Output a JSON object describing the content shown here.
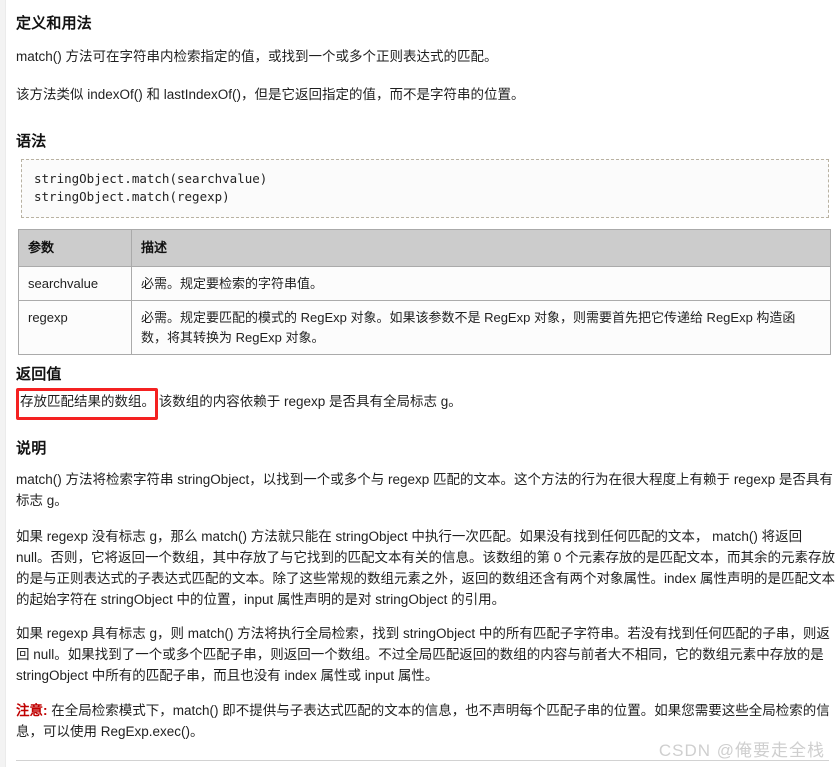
{
  "page": {
    "watermark": "CSDN @俺要走全栈"
  },
  "definition": {
    "heading": "定义和用法",
    "paragraphs": [
      "match() 方法可在字符串内检索指定的值，或找到一个或多个正则表达式的匹配。",
      "该方法类似 indexOf() 和 lastIndexOf()，但是它返回指定的值，而不是字符串的位置。"
    ]
  },
  "syntax": {
    "heading": "语法",
    "code": "stringObject.match(searchvalue)\nstringObject.match(regexp)"
  },
  "params_table": {
    "headers": [
      "参数",
      "描述"
    ],
    "rows": [
      {
        "param": "searchvalue",
        "desc": "必需。规定要检索的字符串值。"
      },
      {
        "param": "regexp",
        "desc": "必需。规定要匹配的模式的 RegExp 对象。如果该参数不是 RegExp 对象，则需要首先把它传递给 RegExp 构造函数，将其转换为 RegExp 对象。"
      }
    ]
  },
  "returns": {
    "heading": "返回值",
    "highlighted": "存放匹配结果的数组。",
    "rest": " 该数组的内容依赖于 regexp 是否具有全局标志 g。",
    "highlight_color": "#f42121"
  },
  "description": {
    "heading": "说明",
    "paragraphs": [
      "match() 方法将检索字符串 stringObject，以找到一个或多个与 regexp 匹配的文本。这个方法的行为在很大程度上有赖于 regexp 是否具有标志 g。",
      "如果 regexp 没有标志 g，那么 match() 方法就只能在 stringObject 中执行一次匹配。如果没有找到任何匹配的文本， match() 将返回 null。否则，它将返回一个数组，其中存放了与它找到的匹配文本有关的信息。该数组的第 0 个元素存放的是匹配文本，而其余的元素存放的是与正则表达式的子表达式匹配的文本。除了这些常规的数组元素之外，返回的数组还含有两个对象属性。index 属性声明的是匹配文本的起始字符在 stringObject 中的位置，input 属性声明的是对 stringObject 的引用。",
      "如果 regexp 具有标志 g，则 match() 方法将执行全局检索，找到 stringObject 中的所有匹配子字符串。若没有找到任何匹配的子串，则返回 null。如果找到了一个或多个匹配子串，则返回一个数组。不过全局匹配返回的数组的内容与前者大不相同，它的数组元素中存放的是 stringObject 中所有的匹配子串，而且也没有 index 属性或 input 属性。"
    ],
    "note_label": "注意:",
    "note_text": " 在全局检索模式下，match() 即不提供与子表达式匹配的文本的信息，也不声明每个匹配子串的位置。如果您需要这些全局检索的信息，可以使用 RegExp.exec()。"
  }
}
